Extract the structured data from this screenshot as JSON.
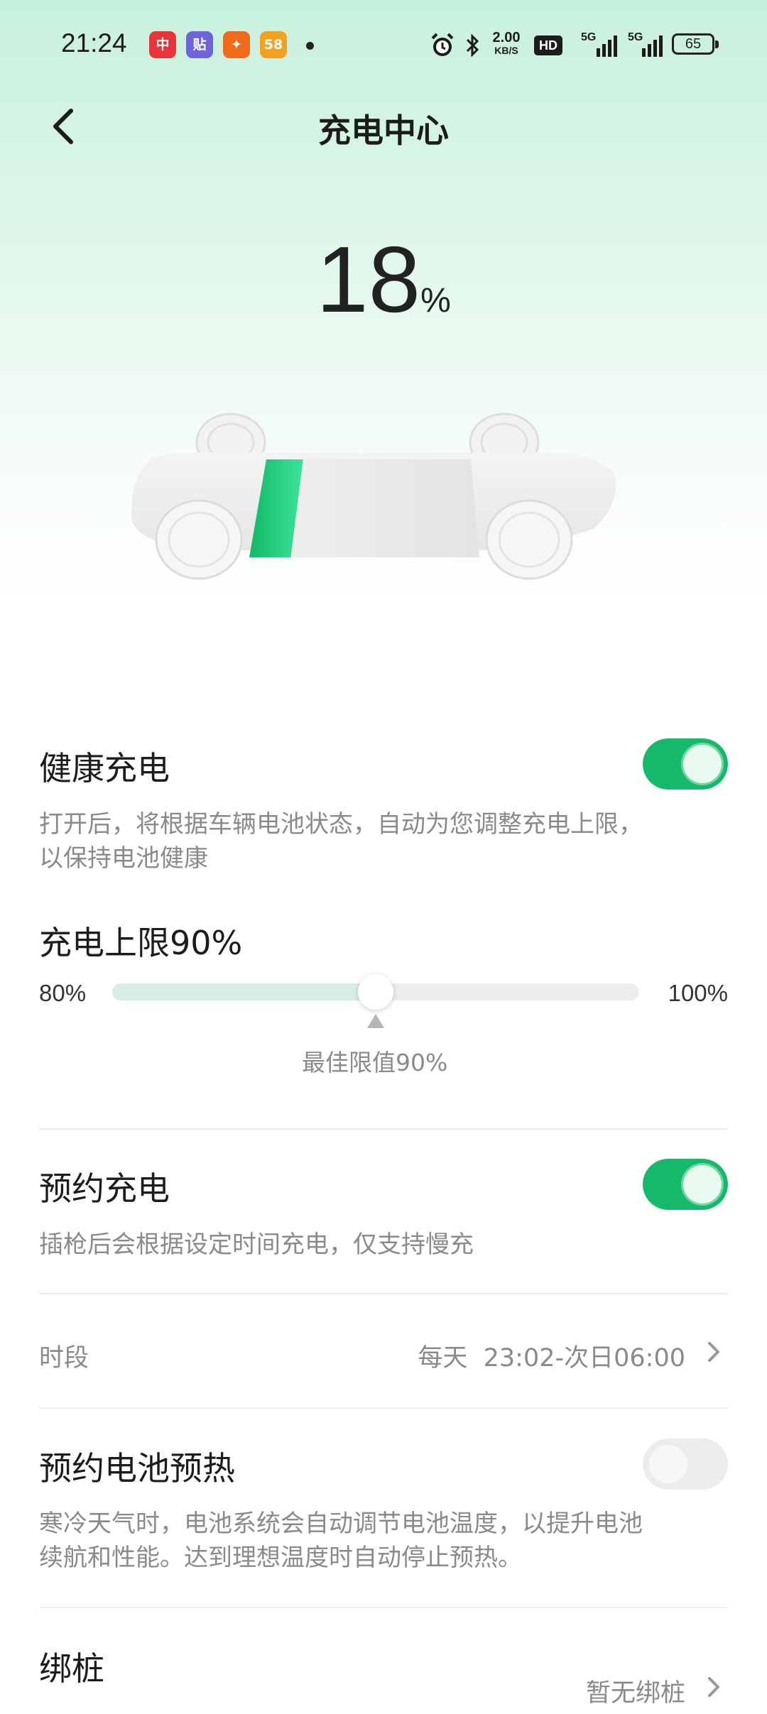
{
  "status_bar": {
    "time": "21:24",
    "app_icons": [
      {
        "label": "中",
        "name": "app-icon-1",
        "color": "#e8333a"
      },
      {
        "label": "贴",
        "name": "app-icon-2",
        "color": "#6f63d9"
      },
      {
        "label": "✦",
        "name": "app-icon-3",
        "color": "#f06a1c"
      },
      {
        "label": "58",
        "name": "app-icon-4",
        "color": "#f3a11f"
      }
    ],
    "net_speed_value": "2.00",
    "net_speed_unit": "KB/S",
    "hd_label": "HD",
    "signal_1": "5G",
    "signal_2": "5G",
    "battery": "65"
  },
  "header": {
    "title": "充电中心"
  },
  "charge": {
    "percent_value": "18",
    "percent_unit": "%",
    "battery_level": 0.18,
    "fill_color": "#1fc777"
  },
  "healthy_charging": {
    "title": "健康充电",
    "enabled": true,
    "description": "打开后，将根据车辆电池状态，自动为您调整充电上限，以保持电池健康"
  },
  "charge_limit": {
    "title": "充电上限90%",
    "min_label": "80%",
    "max_label": "100%",
    "min": 80,
    "max": 100,
    "value": 90,
    "optimal_label": "最佳限值90%"
  },
  "scheduled_charging": {
    "title": "预约充电",
    "enabled": true,
    "description": "插枪后会根据设定时间充电，仅支持慢充",
    "period_label": "时段",
    "period_value": "每天  23:02-次日06:00"
  },
  "battery_preheat": {
    "title": "预约电池预热",
    "enabled": false,
    "description": "寒冷天气时，电池系统会自动调节电池温度，以提升电池续航和性能。达到理想温度时自动停止预热。"
  },
  "bind_pile": {
    "title": "绑桩",
    "value": "暂无绑桩"
  },
  "colors": {
    "accent": "#15b96a",
    "text_secondary": "#8a8a8a"
  }
}
